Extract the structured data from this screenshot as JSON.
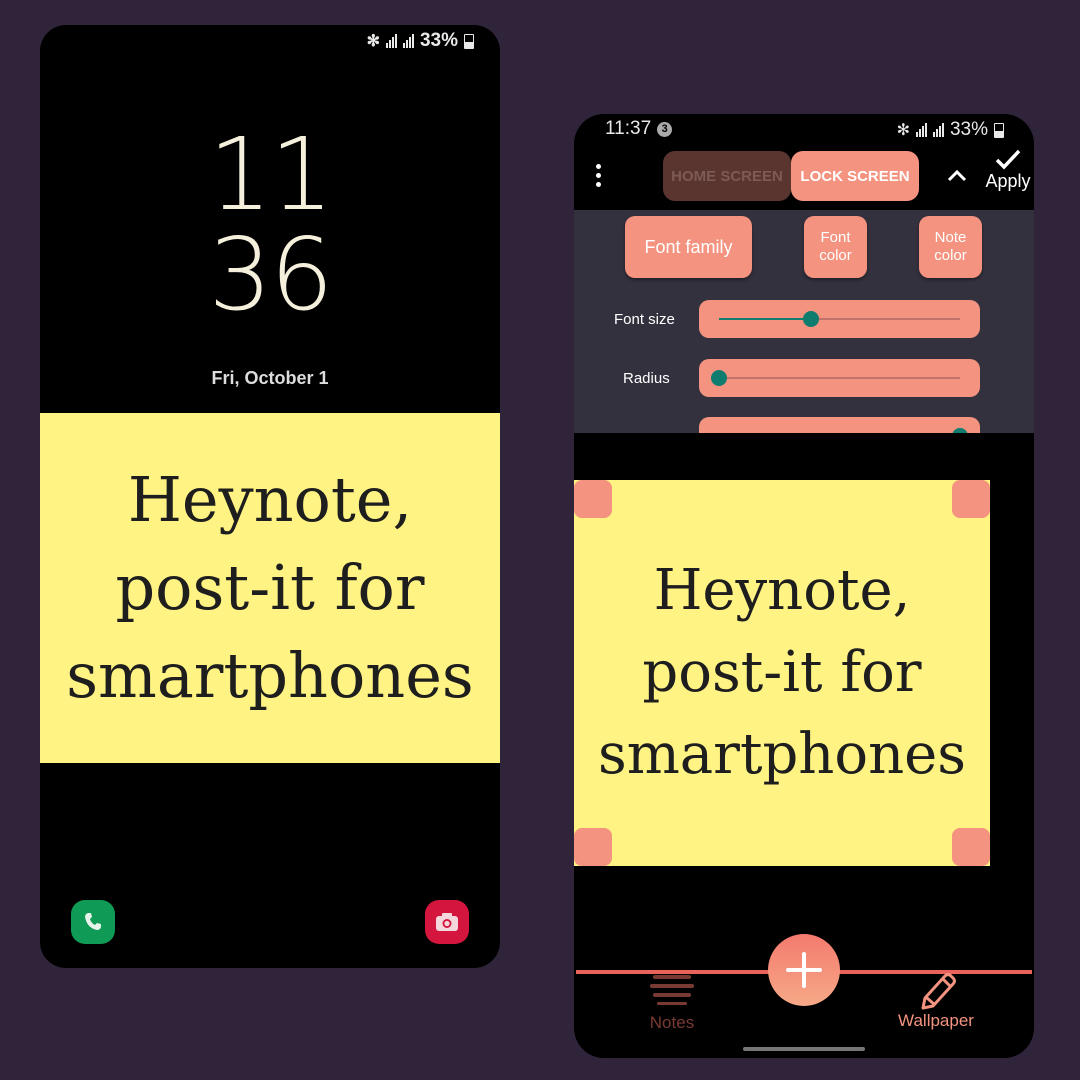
{
  "lock_screen": {
    "status": {
      "battery": "33%"
    },
    "clock_hour": "11",
    "clock_minute": "36",
    "date": "Fri, October 1",
    "note_text": "Heynote,\npost-it for\nsmartphones",
    "shortcuts": [
      {
        "icon": "phone-icon"
      },
      {
        "icon": "camera-icon"
      }
    ]
  },
  "editor": {
    "status": {
      "time": "11:37",
      "notification_count": "3",
      "battery": "33%"
    },
    "tabs": {
      "home": "HOME SCREEN",
      "lock": "LOCK SCREEN",
      "active": "lock"
    },
    "apply_label": "Apply",
    "options": {
      "font_family": "Font family",
      "font_color": "Font color",
      "note_color": "Note color"
    },
    "sliders": [
      {
        "label": "Font size",
        "value": 0.38
      },
      {
        "label": "Radius",
        "value": 0.0
      },
      {
        "label": "",
        "value": 1.0
      }
    ],
    "note_text": "Heynote,\npost-it for\nsmartphones",
    "nav": {
      "notes": "Notes",
      "wallpaper": "Wallpaper",
      "active": "wallpaper"
    },
    "colors": {
      "accent": "#f4937f",
      "note": "#fff383",
      "slider_knob": "#0e7c6e",
      "nav_line": "#e9635a"
    }
  }
}
